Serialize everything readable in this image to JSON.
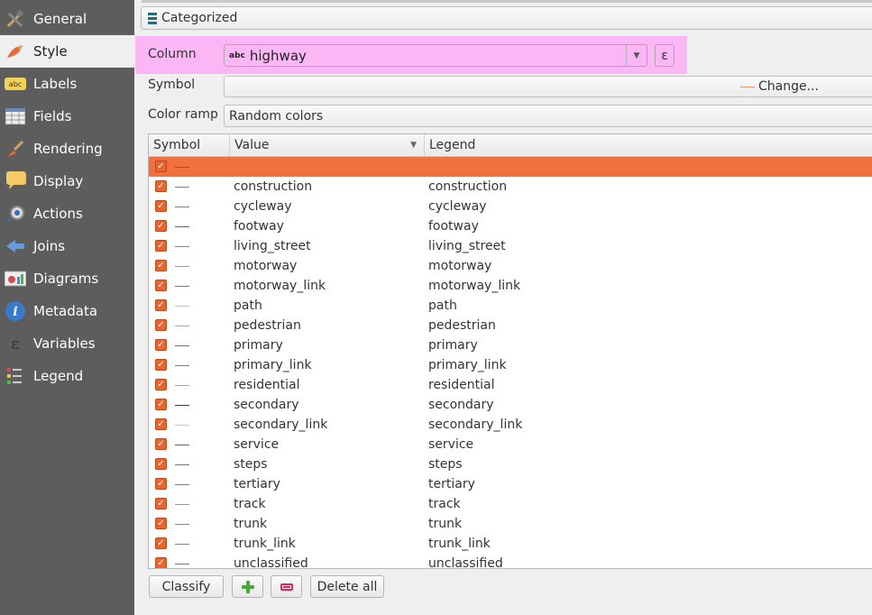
{
  "sidebar": {
    "items": [
      {
        "label": "General",
        "icon": "tools-icon",
        "active": false
      },
      {
        "label": "Style",
        "icon": "paintbrush-icon",
        "active": true
      },
      {
        "label": "Labels",
        "icon": "abc-label-icon",
        "active": false
      },
      {
        "label": "Fields",
        "icon": "table-icon",
        "active": false
      },
      {
        "label": "Rendering",
        "icon": "brush-icon",
        "active": false
      },
      {
        "label": "Display",
        "icon": "speech-bubble-icon",
        "active": false
      },
      {
        "label": "Actions",
        "icon": "gear-icon",
        "active": false
      },
      {
        "label": "Joins",
        "icon": "join-arrow-icon",
        "active": false
      },
      {
        "label": "Diagrams",
        "icon": "diagram-icon",
        "active": false
      },
      {
        "label": "Metadata",
        "icon": "info-icon",
        "active": false
      },
      {
        "label": "Variables",
        "icon": "epsilon-icon",
        "active": false
      },
      {
        "label": "Legend",
        "icon": "legend-icon",
        "active": false
      }
    ]
  },
  "renderer": {
    "value": "Categorized"
  },
  "column": {
    "label": "Column",
    "type_icon": "abc",
    "value": "highway",
    "expression_glyph": "ε"
  },
  "symbol": {
    "label": "Symbol",
    "change_label": "Change...",
    "line_color": "#e39a6c"
  },
  "color_ramp": {
    "label": "Color ramp",
    "value": "Random colors"
  },
  "table": {
    "headers": [
      "Symbol",
      "Value",
      "Legend"
    ],
    "rows": [
      {
        "value": "",
        "legend": "",
        "color": "#e8652f",
        "selected": true
      },
      {
        "value": "construction",
        "legend": "construction",
        "color": "#3aa27a"
      },
      {
        "value": "cycleway",
        "legend": "cycleway",
        "color": "#2fa89a"
      },
      {
        "value": "footway",
        "legend": "footway",
        "color": "#c23a4a"
      },
      {
        "value": "living_street",
        "legend": "living_street",
        "color": "#3aa89a"
      },
      {
        "value": "motorway",
        "legend": "motorway",
        "color": "#d9826a"
      },
      {
        "value": "motorway_link",
        "legend": "motorway_link",
        "color": "#c04a9a"
      },
      {
        "value": "path",
        "legend": "path",
        "color": "#d6c87a"
      },
      {
        "value": "pedestrian",
        "legend": "pedestrian",
        "color": "#7ab8b8"
      },
      {
        "value": "primary",
        "legend": "primary",
        "color": "#a94ab8"
      },
      {
        "value": "primary_link",
        "legend": "primary_link",
        "color": "#3aa86a"
      },
      {
        "value": "residential",
        "legend": "residential",
        "color": "#d68ab8"
      },
      {
        "value": "secondary",
        "legend": "secondary",
        "color": "#2a3a7a"
      },
      {
        "value": "secondary_link",
        "legend": "secondary_link",
        "color": "#e2d84a"
      },
      {
        "value": "service",
        "legend": "service",
        "color": "#b83a5a"
      },
      {
        "value": "steps",
        "legend": "steps",
        "color": "#2a9a8a"
      },
      {
        "value": "tertiary",
        "legend": "tertiary",
        "color": "#2aa88a"
      },
      {
        "value": "track",
        "legend": "track",
        "color": "#e07a6a"
      },
      {
        "value": "trunk",
        "legend": "trunk",
        "color": "#3aa8b8"
      },
      {
        "value": "trunk_link",
        "legend": "trunk_link",
        "color": "#2aa89a"
      },
      {
        "value": "unclassified",
        "legend": "unclassified",
        "color": "#3a9a5a"
      }
    ]
  },
  "buttons": {
    "classify": "Classify",
    "add_icon": "plus-icon",
    "remove_icon": "minus-icon",
    "delete_all": "Delete all"
  }
}
